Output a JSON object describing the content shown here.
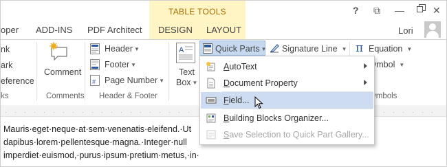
{
  "window": {
    "contextual_tab_title": "TABLE TOOLS",
    "help": "?",
    "restore": "⧉",
    "minimize": "—",
    "close": "✕",
    "user_name": "Lori"
  },
  "tabs": [
    {
      "label": "oper"
    },
    {
      "label": "ADD-INS"
    },
    {
      "label": "PDF Architect"
    },
    {
      "label": "DESIGN"
    },
    {
      "label": "LAYOUT"
    }
  ],
  "ribbon": {
    "left_partial": [
      "nk",
      "ark",
      "eference"
    ],
    "left_partial_group": "ks",
    "comment": "Comment",
    "comments_group": "Comments",
    "header": "Header",
    "footer": "Footer",
    "page_number": "Page Number",
    "header_footer_group": "Header & Footer",
    "text_box_line1": "Text",
    "text_box_line2": "Box",
    "quick_parts": "Quick Parts",
    "signature_line": "Signature Line",
    "equation": "Equation",
    "symbol": "ymbol",
    "symbols_group": "ymbols"
  },
  "document": {
    "lines": [
      "Mauris·eget·neque·at·sem·venenatis·eleifend.·Ut",
      "dapibus·lorem·pellentesque·magna.·Integer·null",
      "imperdiet·euismod,·purus·ipsum·pretium·metus,·in·"
    ]
  },
  "quick_parts_menu": {
    "items": [
      {
        "label": "AutoText",
        "submenu": true
      },
      {
        "label": "Document Property",
        "submenu": true
      },
      {
        "label": "Field...",
        "highlighted": true
      },
      {
        "label": "Building Blocks Organizer..."
      },
      {
        "label": "Save Selection to Quick Part Gallery...",
        "disabled": true
      }
    ]
  },
  "colors": {
    "contextual_tab_bg": "#fff4c4",
    "contextual_tab_text": "#a56d00",
    "menu_highlight": "#cddcf0",
    "button_active": "#c5d8ef",
    "accent_blue": "#2b579a"
  }
}
